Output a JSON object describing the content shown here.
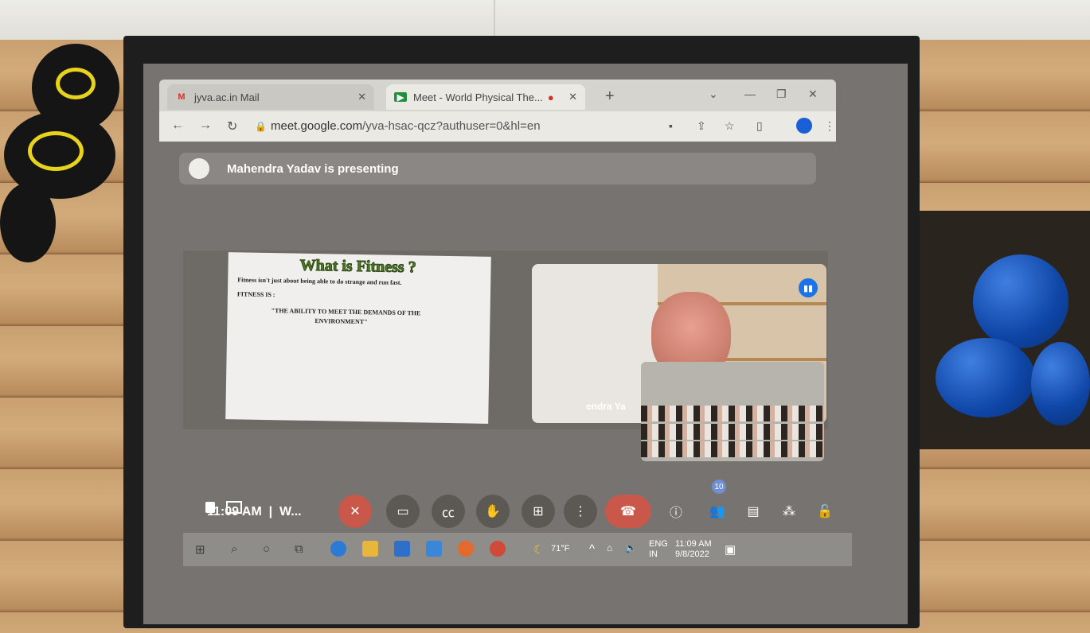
{
  "browser": {
    "tabs": [
      {
        "label": "jyva.ac.in Mail",
        "icon": "gmail-icon"
      },
      {
        "label": "Meet - World Physical The...",
        "icon": "meet-icon"
      }
    ],
    "url_host": "meet.google.com",
    "url_path": "/yva-hsac-qcz?authuser=0&hl=en"
  },
  "meet": {
    "presenting_text": "Mahendra Yadav is presenting",
    "slide": {
      "title": "What is Fitness ?",
      "line1": "Fitness isn't just about being able to do strange and run fast.",
      "line2": "FITNESS IS :",
      "line3": "\"THE ABILITY TO MEET THE DEMANDS OF THE",
      "line4": "ENVIRONMENT\""
    },
    "participant_name": "endra Ya",
    "clock": "11:09 AM",
    "meeting_short": "W...",
    "participant_count": "10"
  },
  "taskbar": {
    "weather": "71°F",
    "lang1": "ENG",
    "lang2": "IN",
    "time": "11:09 AM",
    "date": "9/8/2022"
  }
}
